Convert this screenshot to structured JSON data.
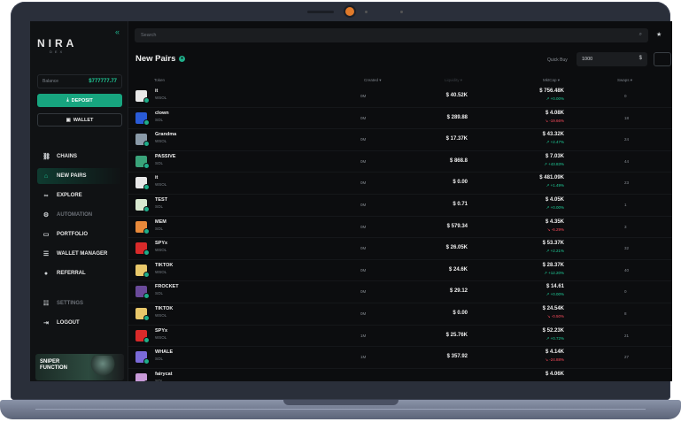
{
  "sidebar": {
    "logo": "NIRA",
    "logo_sub": "DEX",
    "collapse_icon": "double-chevron-left-icon",
    "balance_label": "Balance",
    "balance_value": "$777777.77",
    "deposit_label": "DEPOSIT",
    "wallet_label": "WALLET",
    "nav": [
      {
        "label": "CHAINS",
        "icon": "link-icon",
        "active": false
      },
      {
        "label": "NEW PAIRS",
        "icon": "home-icon",
        "active": true
      },
      {
        "label": "EXPLORE",
        "icon": "binoculars-icon",
        "active": false
      },
      {
        "label": "AUTOMATION",
        "icon": "gear-icon",
        "active": false
      },
      {
        "label": "PORTFOLIO",
        "icon": "briefcase-icon",
        "active": false
      },
      {
        "label": "WALLET MANAGER",
        "icon": "sliders-icon",
        "active": false
      },
      {
        "label": "REFERRAL",
        "icon": "referral-icon",
        "active": false
      },
      {
        "label": "SETTINGS",
        "icon": "settings-icon",
        "active": false
      },
      {
        "label": "LOGOUT",
        "icon": "logout-icon",
        "active": false
      }
    ],
    "sniper_label": "SNIPER FUNCTION"
  },
  "header": {
    "search_placeholder": "Search",
    "page_title": "New Pairs",
    "quick_buy_label": "Quick Buy",
    "quick_buy_value": "1000",
    "currency_symbol": "$"
  },
  "table": {
    "columns": {
      "token": "Token",
      "created": "Created ▾",
      "liquidity": "Liquidity ▾",
      "mcap": "MktCap ▾",
      "swaps": "Swaps ▾"
    },
    "rows": [
      {
        "name": "it",
        "pair": "WSOL",
        "created": "0M",
        "liquidity": "$ 40.52K",
        "mcap": "$ 756.48K",
        "change": "↗ +0.00%",
        "dir": "up",
        "swaps": "0",
        "icon_color": "#e8e8e8"
      },
      {
        "name": "clown",
        "pair": "SOL",
        "created": "0M",
        "liquidity": "$ 289.88",
        "mcap": "$ 4.08K",
        "change": "↘ -19.66%",
        "dir": "down",
        "swaps": "18",
        "icon_color": "#2a5bd7"
      },
      {
        "name": "Grandma",
        "pair": "WSOL",
        "created": "0M",
        "liquidity": "$ 17.37K",
        "mcap": "$ 43.32K",
        "change": "↗ +2.47%",
        "dir": "up",
        "swaps": "24",
        "icon_color": "#8a9aa8"
      },
      {
        "name": "PASSIVE",
        "pair": "SOL",
        "created": "0M",
        "liquidity": "$ 868.8",
        "mcap": "$ 7.03K",
        "change": "↗ +43.83%",
        "dir": "up",
        "swaps": "44",
        "icon_color": "#3aa37a"
      },
      {
        "name": "it",
        "pair": "WSOL",
        "created": "0M",
        "liquidity": "$ 0.00",
        "mcap": "$ 481.09K",
        "change": "↗ +1.49%",
        "dir": "up",
        "swaps": "23",
        "icon_color": "#e8e8e8"
      },
      {
        "name": "TEST",
        "pair": "SOL",
        "created": "0M",
        "liquidity": "$ 0.71",
        "mcap": "$ 4.05K",
        "change": "↗ +0.00%",
        "dir": "up",
        "swaps": "1",
        "icon_color": "#d8e8d0"
      },
      {
        "name": "MEM",
        "pair": "SOL",
        "created": "0M",
        "liquidity": "$ 579.34",
        "mcap": "$ 4.35K",
        "change": "↘ -6.29%",
        "dir": "down",
        "swaps": "3",
        "icon_color": "#e8893a"
      },
      {
        "name": "SPYx",
        "pair": "WSOL",
        "created": "0M",
        "liquidity": "$ 26.05K",
        "mcap": "$ 53.37K",
        "change": "↗ +2.21%",
        "dir": "up",
        "swaps": "32",
        "icon_color": "#d92a2a"
      },
      {
        "name": "TIKTOK",
        "pair": "WSOL",
        "created": "0M",
        "liquidity": "$ 24.6K",
        "mcap": "$ 28.37K",
        "change": "↗ +12.20%",
        "dir": "up",
        "swaps": "40",
        "icon_color": "#e8c76a"
      },
      {
        "name": "FROCKET",
        "pair": "SOL",
        "created": "0M",
        "liquidity": "$ 29.12",
        "mcap": "$ 14.61",
        "change": "↗ +0.00%",
        "dir": "up",
        "swaps": "0",
        "icon_color": "#6a4a9a"
      },
      {
        "name": "TIKTOK",
        "pair": "WSOL",
        "created": "0M",
        "liquidity": "$ 0.00",
        "mcap": "$ 24.54K",
        "change": "↘ -0.50%",
        "dir": "down",
        "swaps": "8",
        "icon_color": "#e8c76a"
      },
      {
        "name": "SPYx",
        "pair": "WSOL",
        "created": "1M",
        "liquidity": "$ 25.76K",
        "mcap": "$ 52.23K",
        "change": "↗ +0.72%",
        "dir": "up",
        "swaps": "21",
        "icon_color": "#d92a2a"
      },
      {
        "name": "WHALE",
        "pair": "SOL",
        "created": "1M",
        "liquidity": "$ 357.92",
        "mcap": "$ 4.14K",
        "change": "↘ -24.88%",
        "dir": "down",
        "swaps": "27",
        "icon_color": "#7a6ad8"
      },
      {
        "name": "fairycat",
        "pair": "SOL",
        "created": "",
        "liquidity": "",
        "mcap": "$ 4.06K",
        "change": "",
        "dir": "up",
        "swaps": "",
        "icon_color": "#c89ad8"
      }
    ]
  }
}
